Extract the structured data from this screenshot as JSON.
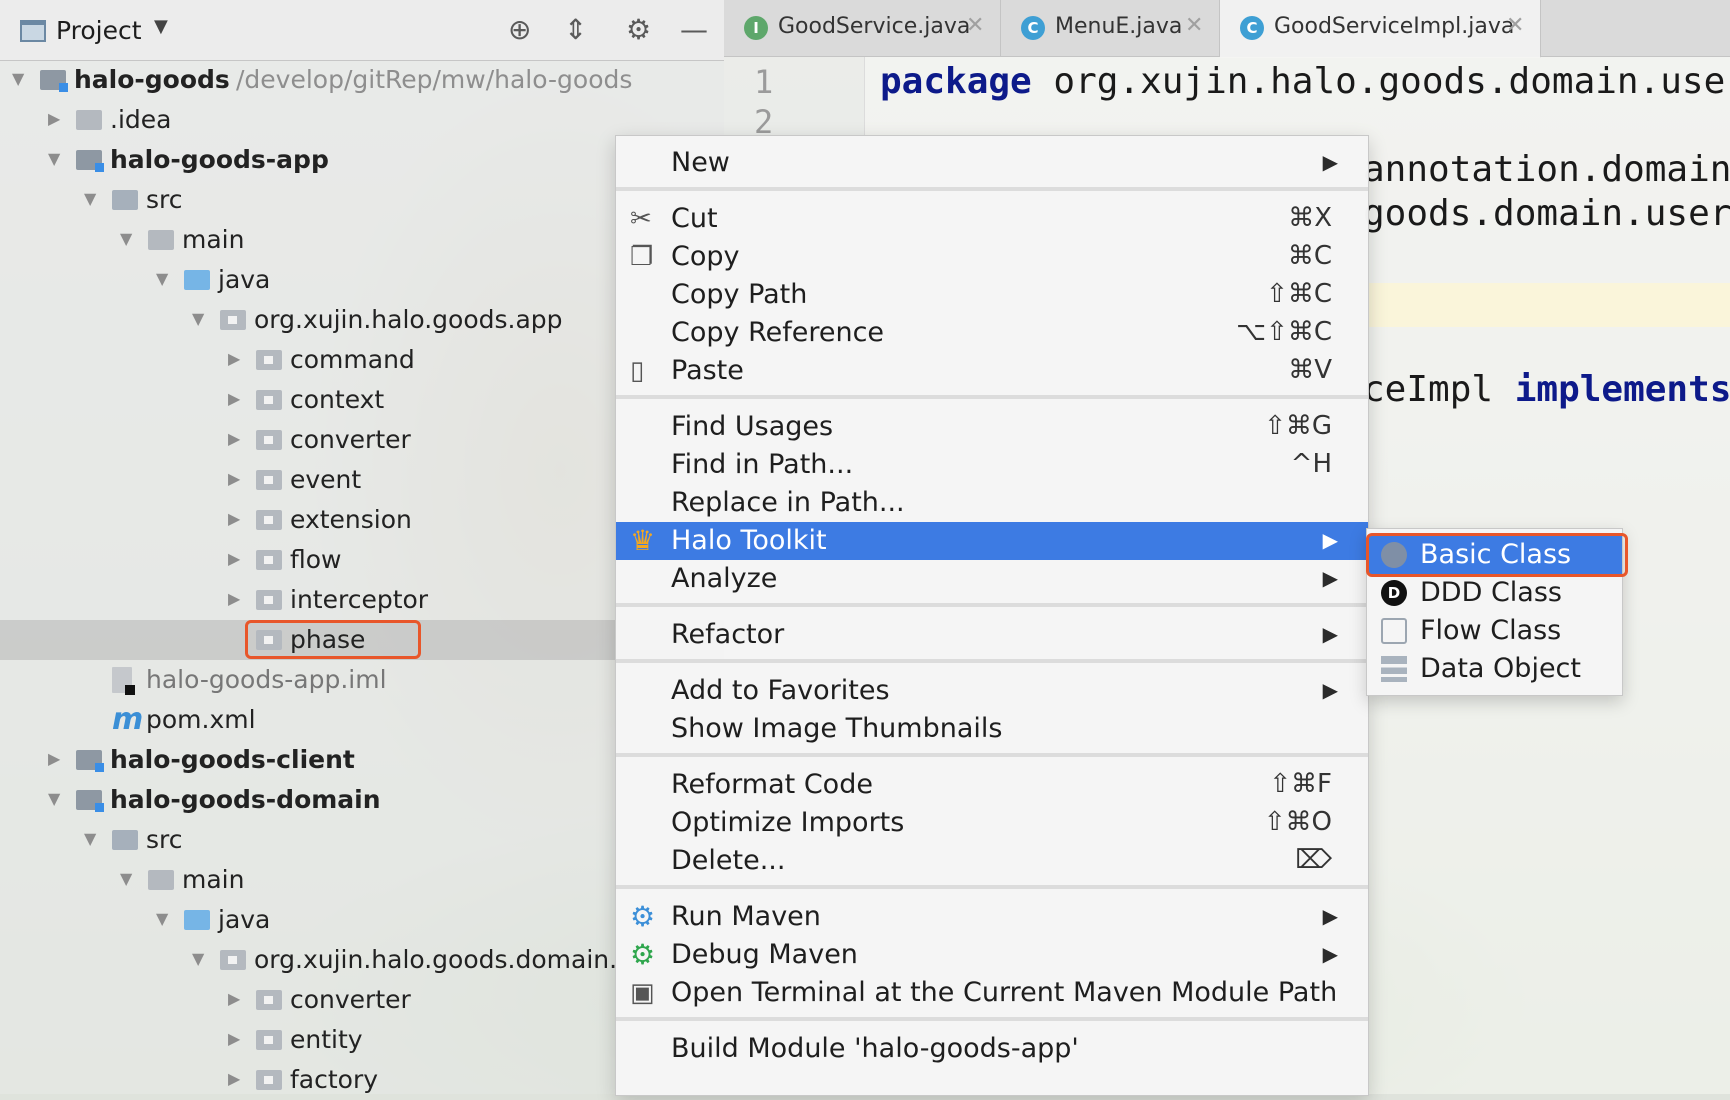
{
  "project_panel": {
    "title": "Project",
    "tree": [
      {
        "label": "halo-goods",
        "path": "/develop/gitRep/mw/halo-goods",
        "bold": true,
        "arrow": "▼",
        "icon": "module-folder-icon",
        "depth": 0
      },
      {
        "label": ".idea",
        "bold": false,
        "arrow": "▶",
        "icon": "folder-icon",
        "depth": 1
      },
      {
        "label": "halo-goods-app",
        "bold": true,
        "arrow": "▼",
        "icon": "module-folder-icon",
        "depth": 1
      },
      {
        "label": "src",
        "bold": false,
        "arrow": "▼",
        "icon": "source-folder-icon",
        "depth": 2
      },
      {
        "label": "main",
        "bold": false,
        "arrow": "▼",
        "icon": "folder-icon",
        "depth": 3
      },
      {
        "label": "java",
        "bold": false,
        "arrow": "▼",
        "icon": "java-source-root-icon",
        "depth": 4
      },
      {
        "label": "org.xujin.halo.goods.app",
        "bold": false,
        "arrow": "▼",
        "icon": "package-icon",
        "depth": 5
      },
      {
        "label": "command",
        "bold": false,
        "arrow": "▶",
        "icon": "package-icon",
        "depth": 6
      },
      {
        "label": "context",
        "bold": false,
        "arrow": "▶",
        "icon": "package-icon",
        "depth": 6
      },
      {
        "label": "converter",
        "bold": false,
        "arrow": "▶",
        "icon": "package-icon",
        "depth": 6
      },
      {
        "label": "event",
        "bold": false,
        "arrow": "▶",
        "icon": "package-icon",
        "depth": 6
      },
      {
        "label": "extension",
        "bold": false,
        "arrow": "▶",
        "icon": "package-icon",
        "depth": 6
      },
      {
        "label": "flow",
        "bold": false,
        "arrow": "▶",
        "icon": "package-icon",
        "depth": 6
      },
      {
        "label": "interceptor",
        "bold": false,
        "arrow": "▶",
        "icon": "package-icon",
        "depth": 6
      },
      {
        "label": "phase",
        "bold": false,
        "arrow": "",
        "icon": "package-icon",
        "depth": 6,
        "selected": true
      },
      {
        "label": "halo-goods-app.iml",
        "bold": false,
        "arrow": "",
        "icon": "iml-file-icon",
        "depth": 2,
        "muted": true
      },
      {
        "label": "pom.xml",
        "bold": false,
        "arrow": "",
        "icon": "maven-pom-icon",
        "depth": 2
      },
      {
        "label": "halo-goods-client",
        "bold": true,
        "arrow": "▶",
        "icon": "module-folder-icon",
        "depth": 1
      },
      {
        "label": "halo-goods-domain",
        "bold": true,
        "arrow": "▼",
        "icon": "module-folder-icon",
        "depth": 1
      },
      {
        "label": "src",
        "bold": false,
        "arrow": "▼",
        "icon": "source-folder-icon",
        "depth": 2
      },
      {
        "label": "main",
        "bold": false,
        "arrow": "▼",
        "icon": "folder-icon",
        "depth": 3
      },
      {
        "label": "java",
        "bold": false,
        "arrow": "▼",
        "icon": "java-source-root-icon",
        "depth": 4
      },
      {
        "label": "org.xujin.halo.goods.domain.",
        "bold": false,
        "arrow": "▼",
        "icon": "package-icon",
        "depth": 5
      },
      {
        "label": "converter",
        "bold": false,
        "arrow": "▶",
        "icon": "package-icon",
        "depth": 6
      },
      {
        "label": "entity",
        "bold": false,
        "arrow": "▶",
        "icon": "package-icon",
        "depth": 6
      },
      {
        "label": "factory",
        "bold": false,
        "arrow": "▶",
        "icon": "package-icon",
        "depth": 6
      }
    ]
  },
  "editor": {
    "tabs": [
      {
        "label": "GoodService.java",
        "icon_letter": "I",
        "icon": "interface-icon",
        "active": false
      },
      {
        "label": "MenuE.java",
        "icon_letter": "C",
        "icon": "class-icon",
        "active": false
      },
      {
        "label": "GoodServiceImpl.java",
        "icon_letter": "C",
        "icon": "class-icon",
        "active": true
      }
    ],
    "line_numbers": [
      "1",
      "2"
    ],
    "code": {
      "line1_keyword": "package",
      "line1_rest": " org.xujin.halo.goods.domain.use",
      "line3": "annotation.domain",
      "line4": "goods.domain.user",
      "line_impl_text": "ceImpl ",
      "line_impl_keyword": "implements"
    }
  },
  "context_menu": {
    "groups": [
      [
        {
          "label": "New",
          "shortcut": "",
          "submenu": true,
          "icon": ""
        }
      ],
      [
        {
          "label": "Cut",
          "shortcut": "⌘X",
          "submenu": false,
          "icon": "scissors-icon"
        },
        {
          "label": "Copy",
          "shortcut": "⌘C",
          "submenu": false,
          "icon": "copy-icon"
        },
        {
          "label": "Copy Path",
          "shortcut": "⇧⌘C",
          "submenu": false,
          "icon": ""
        },
        {
          "label": "Copy Reference",
          "shortcut": "⌥⇧⌘C",
          "submenu": false,
          "icon": ""
        },
        {
          "label": "Paste",
          "shortcut": "⌘V",
          "submenu": false,
          "icon": "clipboard-icon"
        }
      ],
      [
        {
          "label": "Find Usages",
          "shortcut": "⇧⌘G",
          "submenu": false,
          "icon": ""
        },
        {
          "label": "Find in Path...",
          "shortcut": "^H",
          "submenu": false,
          "icon": ""
        },
        {
          "label": "Replace in Path...",
          "shortcut": "",
          "submenu": false,
          "icon": ""
        },
        {
          "label": "Halo Toolkit",
          "shortcut": "",
          "submenu": true,
          "icon": "crown-icon",
          "hover": true
        },
        {
          "label": "Analyze",
          "shortcut": "",
          "submenu": true,
          "icon": ""
        }
      ],
      [
        {
          "label": "Refactor",
          "shortcut": "",
          "submenu": true,
          "icon": ""
        }
      ],
      [
        {
          "label": "Add to Favorites",
          "shortcut": "",
          "submenu": true,
          "icon": ""
        },
        {
          "label": "Show Image Thumbnails",
          "shortcut": "",
          "submenu": false,
          "icon": ""
        }
      ],
      [
        {
          "label": "Reformat Code",
          "shortcut": "⇧⌘F",
          "submenu": false,
          "icon": ""
        },
        {
          "label": "Optimize Imports",
          "shortcut": "⇧⌘O",
          "submenu": false,
          "icon": ""
        },
        {
          "label": "Delete...",
          "shortcut": "⌦",
          "submenu": false,
          "icon": ""
        }
      ],
      [
        {
          "label": "Run Maven",
          "shortcut": "",
          "submenu": true,
          "icon": "maven-gear-icon"
        },
        {
          "label": "Debug Maven",
          "shortcut": "",
          "submenu": true,
          "icon": "maven-debug-gear-icon"
        },
        {
          "label": "Open Terminal at the Current Maven Module Path",
          "shortcut": "",
          "submenu": false,
          "icon": "terminal-icon"
        }
      ],
      [
        {
          "label": "Build Module 'halo-goods-app'",
          "shortcut": "",
          "submenu": false,
          "icon": ""
        }
      ]
    ]
  },
  "submenu": {
    "items": [
      {
        "label": "Basic Class",
        "icon": "basic-class-icon",
        "hover": true
      },
      {
        "label": "DDD Class",
        "icon": "ddd-class-icon",
        "icon_letter": "D"
      },
      {
        "label": "Flow Class",
        "icon": "flow-class-icon"
      },
      {
        "label": "Data Object",
        "icon": "data-object-icon"
      }
    ]
  },
  "colors": {
    "menu_highlight": "#3d7be3",
    "annotation_outline": "#e8562a",
    "keyword": "#0d1a8a"
  }
}
